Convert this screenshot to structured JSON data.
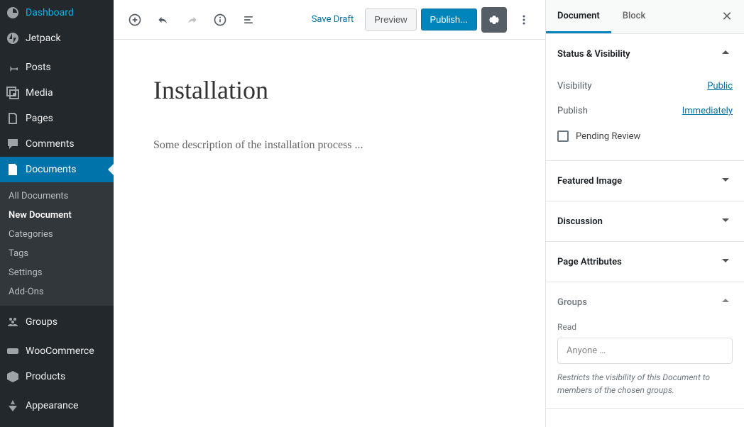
{
  "sidebar": {
    "items": [
      {
        "icon": "dashboard",
        "label": "Dashboard"
      },
      {
        "icon": "jetpack",
        "label": "Jetpack"
      },
      {
        "icon": "pin",
        "label": "Posts"
      },
      {
        "icon": "media",
        "label": "Media"
      },
      {
        "icon": "page",
        "label": "Pages"
      },
      {
        "icon": "comment",
        "label": "Comments"
      },
      {
        "icon": "document",
        "label": "Documents"
      },
      {
        "icon": "groups",
        "label": "Groups"
      },
      {
        "icon": "woo",
        "label": "WooCommerce"
      },
      {
        "icon": "products",
        "label": "Products"
      },
      {
        "icon": "appearance",
        "label": "Appearance"
      }
    ],
    "submenu": [
      {
        "label": "All Documents"
      },
      {
        "label": "New Document",
        "active": true
      },
      {
        "label": "Categories"
      },
      {
        "label": "Tags"
      },
      {
        "label": "Settings"
      },
      {
        "label": "Add-Ons"
      }
    ]
  },
  "toolbar": {
    "save_draft": "Save Draft",
    "preview": "Preview",
    "publish": "Publish..."
  },
  "editor": {
    "title": "Installation",
    "content": "Some description of the installation process ..."
  },
  "inspector": {
    "tabs": [
      {
        "label": "Document",
        "active": true
      },
      {
        "label": "Block"
      }
    ],
    "status_visibility": {
      "title": "Status & Visibility",
      "visibility_label": "Visibility",
      "visibility_value": "Public",
      "publish_label": "Publish",
      "publish_value": "Immediately",
      "pending_review": "Pending Review"
    },
    "panels": {
      "featured_image": "Featured Image",
      "discussion": "Discussion",
      "page_attributes": "Page Attributes"
    },
    "groups": {
      "title": "Groups",
      "read_label": "Read",
      "placeholder": "Anyone …",
      "help": "Restricts the visibility of this Document to members of the chosen groups."
    }
  }
}
